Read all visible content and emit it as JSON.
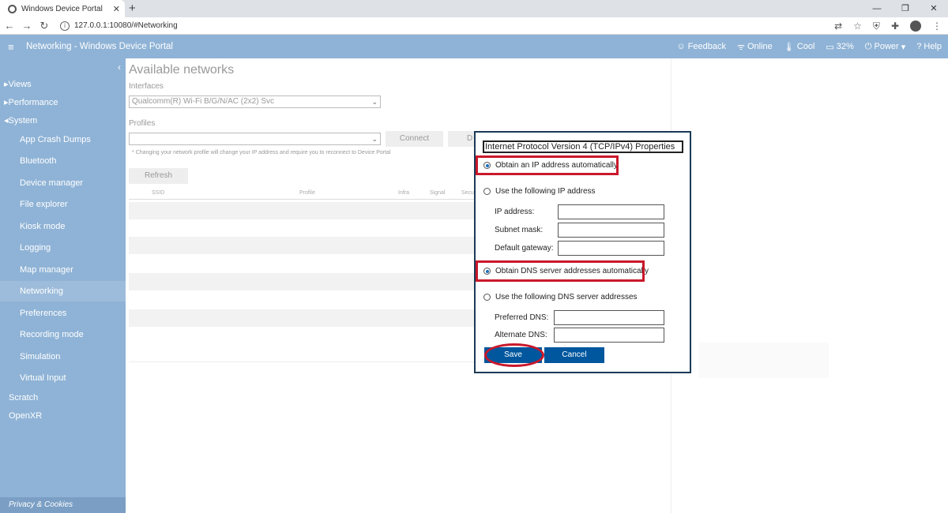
{
  "browser": {
    "tab_title": "Windows Device Portal",
    "new_tab": "+",
    "url": "127.0.0.1:10080/#Networking",
    "window_controls": [
      "—",
      "❐",
      "✕"
    ]
  },
  "header": {
    "menu_icon": "hamburger-icon",
    "title": "Networking - Windows Device Portal",
    "feedback": "Feedback",
    "online": "Online",
    "cool": "Cool",
    "battery": "32%",
    "power": "Power",
    "help": "Help"
  },
  "sidebar": {
    "collapse": "‹",
    "roots": [
      {
        "label": "Views",
        "prefix": "▸"
      },
      {
        "label": "Performance",
        "prefix": "▸"
      },
      {
        "label": "System",
        "prefix": "◂"
      }
    ],
    "items": [
      {
        "label": "App Crash Dumps"
      },
      {
        "label": "Bluetooth"
      },
      {
        "label": "Device manager"
      },
      {
        "label": "File explorer"
      },
      {
        "label": "Kiosk mode"
      },
      {
        "label": "Logging"
      },
      {
        "label": "Map manager"
      },
      {
        "label": "Networking"
      },
      {
        "label": "Preferences"
      },
      {
        "label": "Recording mode"
      },
      {
        "label": "Simulation"
      },
      {
        "label": "Virtual Input"
      }
    ],
    "bottom": [
      {
        "label": "Scratch"
      },
      {
        "label": "OpenXR"
      }
    ],
    "footer": "Privacy & Cookies"
  },
  "main": {
    "title": "Available networks",
    "interfaces_label": "Interfaces",
    "interface_value": "Qualcomm(R) Wi-Fi B/G/N/AC (2x2) Svc",
    "profiles_label": "Profiles",
    "profile_value": "",
    "connect": "Connect",
    "disconnect": "D",
    "note": "* Changing your network profile will change your IP address and require you to reconnect to Device Portal",
    "refresh": "Refresh",
    "columns": [
      "SSID",
      "Profile",
      "Infra",
      "Signal",
      "Secur"
    ]
  },
  "dialog": {
    "title": "Internet Protocol Version 4 (TCP/IPv4) Properties",
    "ip_auto": "Obtain an IP address automatically",
    "ip_manual": "Use the following IP address",
    "ip_address": "IP address:",
    "subnet_mask": "Subnet mask:",
    "gateway": "Default gateway:",
    "dns_auto": "Obtain DNS server addresses automatically",
    "dns_manual": "Use the following DNS server addresses",
    "preferred_dns": "Preferred DNS:",
    "alternate_dns": "Alternate DNS:",
    "save": "Save",
    "cancel": "Cancel"
  },
  "colors": {
    "sidebar": "#8fb3d6",
    "accent": "#00579e",
    "highlight": "#c9182b"
  }
}
